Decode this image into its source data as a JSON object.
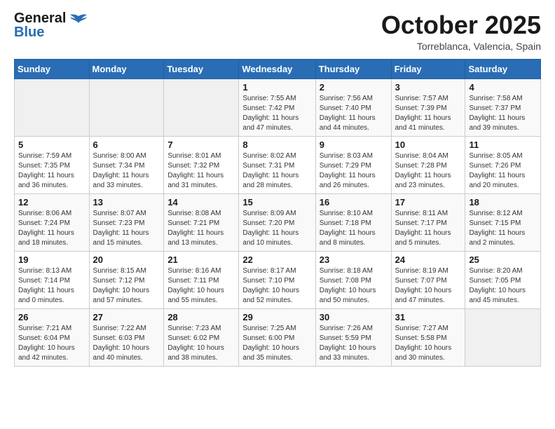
{
  "header": {
    "logo_general": "General",
    "logo_blue": "Blue",
    "month_title": "October 2025",
    "location": "Torreblanca, Valencia, Spain"
  },
  "days_of_week": [
    "Sunday",
    "Monday",
    "Tuesday",
    "Wednesday",
    "Thursday",
    "Friday",
    "Saturday"
  ],
  "weeks": [
    [
      {
        "day": "",
        "sunrise": "",
        "sunset": "",
        "daylight": ""
      },
      {
        "day": "",
        "sunrise": "",
        "sunset": "",
        "daylight": ""
      },
      {
        "day": "",
        "sunrise": "",
        "sunset": "",
        "daylight": ""
      },
      {
        "day": "1",
        "sunrise": "Sunrise: 7:55 AM",
        "sunset": "Sunset: 7:42 PM",
        "daylight": "Daylight: 11 hours and 47 minutes."
      },
      {
        "day": "2",
        "sunrise": "Sunrise: 7:56 AM",
        "sunset": "Sunset: 7:40 PM",
        "daylight": "Daylight: 11 hours and 44 minutes."
      },
      {
        "day": "3",
        "sunrise": "Sunrise: 7:57 AM",
        "sunset": "Sunset: 7:39 PM",
        "daylight": "Daylight: 11 hours and 41 minutes."
      },
      {
        "day": "4",
        "sunrise": "Sunrise: 7:58 AM",
        "sunset": "Sunset: 7:37 PM",
        "daylight": "Daylight: 11 hours and 39 minutes."
      }
    ],
    [
      {
        "day": "5",
        "sunrise": "Sunrise: 7:59 AM",
        "sunset": "Sunset: 7:35 PM",
        "daylight": "Daylight: 11 hours and 36 minutes."
      },
      {
        "day": "6",
        "sunrise": "Sunrise: 8:00 AM",
        "sunset": "Sunset: 7:34 PM",
        "daylight": "Daylight: 11 hours and 33 minutes."
      },
      {
        "day": "7",
        "sunrise": "Sunrise: 8:01 AM",
        "sunset": "Sunset: 7:32 PM",
        "daylight": "Daylight: 11 hours and 31 minutes."
      },
      {
        "day": "8",
        "sunrise": "Sunrise: 8:02 AM",
        "sunset": "Sunset: 7:31 PM",
        "daylight": "Daylight: 11 hours and 28 minutes."
      },
      {
        "day": "9",
        "sunrise": "Sunrise: 8:03 AM",
        "sunset": "Sunset: 7:29 PM",
        "daylight": "Daylight: 11 hours and 26 minutes."
      },
      {
        "day": "10",
        "sunrise": "Sunrise: 8:04 AM",
        "sunset": "Sunset: 7:28 PM",
        "daylight": "Daylight: 11 hours and 23 minutes."
      },
      {
        "day": "11",
        "sunrise": "Sunrise: 8:05 AM",
        "sunset": "Sunset: 7:26 PM",
        "daylight": "Daylight: 11 hours and 20 minutes."
      }
    ],
    [
      {
        "day": "12",
        "sunrise": "Sunrise: 8:06 AM",
        "sunset": "Sunset: 7:24 PM",
        "daylight": "Daylight: 11 hours and 18 minutes."
      },
      {
        "day": "13",
        "sunrise": "Sunrise: 8:07 AM",
        "sunset": "Sunset: 7:23 PM",
        "daylight": "Daylight: 11 hours and 15 minutes."
      },
      {
        "day": "14",
        "sunrise": "Sunrise: 8:08 AM",
        "sunset": "Sunset: 7:21 PM",
        "daylight": "Daylight: 11 hours and 13 minutes."
      },
      {
        "day": "15",
        "sunrise": "Sunrise: 8:09 AM",
        "sunset": "Sunset: 7:20 PM",
        "daylight": "Daylight: 11 hours and 10 minutes."
      },
      {
        "day": "16",
        "sunrise": "Sunrise: 8:10 AM",
        "sunset": "Sunset: 7:18 PM",
        "daylight": "Daylight: 11 hours and 8 minutes."
      },
      {
        "day": "17",
        "sunrise": "Sunrise: 8:11 AM",
        "sunset": "Sunset: 7:17 PM",
        "daylight": "Daylight: 11 hours and 5 minutes."
      },
      {
        "day": "18",
        "sunrise": "Sunrise: 8:12 AM",
        "sunset": "Sunset: 7:15 PM",
        "daylight": "Daylight: 11 hours and 2 minutes."
      }
    ],
    [
      {
        "day": "19",
        "sunrise": "Sunrise: 8:13 AM",
        "sunset": "Sunset: 7:14 PM",
        "daylight": "Daylight: 11 hours and 0 minutes."
      },
      {
        "day": "20",
        "sunrise": "Sunrise: 8:15 AM",
        "sunset": "Sunset: 7:12 PM",
        "daylight": "Daylight: 10 hours and 57 minutes."
      },
      {
        "day": "21",
        "sunrise": "Sunrise: 8:16 AM",
        "sunset": "Sunset: 7:11 PM",
        "daylight": "Daylight: 10 hours and 55 minutes."
      },
      {
        "day": "22",
        "sunrise": "Sunrise: 8:17 AM",
        "sunset": "Sunset: 7:10 PM",
        "daylight": "Daylight: 10 hours and 52 minutes."
      },
      {
        "day": "23",
        "sunrise": "Sunrise: 8:18 AM",
        "sunset": "Sunset: 7:08 PM",
        "daylight": "Daylight: 10 hours and 50 minutes."
      },
      {
        "day": "24",
        "sunrise": "Sunrise: 8:19 AM",
        "sunset": "Sunset: 7:07 PM",
        "daylight": "Daylight: 10 hours and 47 minutes."
      },
      {
        "day": "25",
        "sunrise": "Sunrise: 8:20 AM",
        "sunset": "Sunset: 7:05 PM",
        "daylight": "Daylight: 10 hours and 45 minutes."
      }
    ],
    [
      {
        "day": "26",
        "sunrise": "Sunrise: 7:21 AM",
        "sunset": "Sunset: 6:04 PM",
        "daylight": "Daylight: 10 hours and 42 minutes."
      },
      {
        "day": "27",
        "sunrise": "Sunrise: 7:22 AM",
        "sunset": "Sunset: 6:03 PM",
        "daylight": "Daylight: 10 hours and 40 minutes."
      },
      {
        "day": "28",
        "sunrise": "Sunrise: 7:23 AM",
        "sunset": "Sunset: 6:02 PM",
        "daylight": "Daylight: 10 hours and 38 minutes."
      },
      {
        "day": "29",
        "sunrise": "Sunrise: 7:25 AM",
        "sunset": "Sunset: 6:00 PM",
        "daylight": "Daylight: 10 hours and 35 minutes."
      },
      {
        "day": "30",
        "sunrise": "Sunrise: 7:26 AM",
        "sunset": "Sunset: 5:59 PM",
        "daylight": "Daylight: 10 hours and 33 minutes."
      },
      {
        "day": "31",
        "sunrise": "Sunrise: 7:27 AM",
        "sunset": "Sunset: 5:58 PM",
        "daylight": "Daylight: 10 hours and 30 minutes."
      },
      {
        "day": "",
        "sunrise": "",
        "sunset": "",
        "daylight": ""
      }
    ]
  ]
}
